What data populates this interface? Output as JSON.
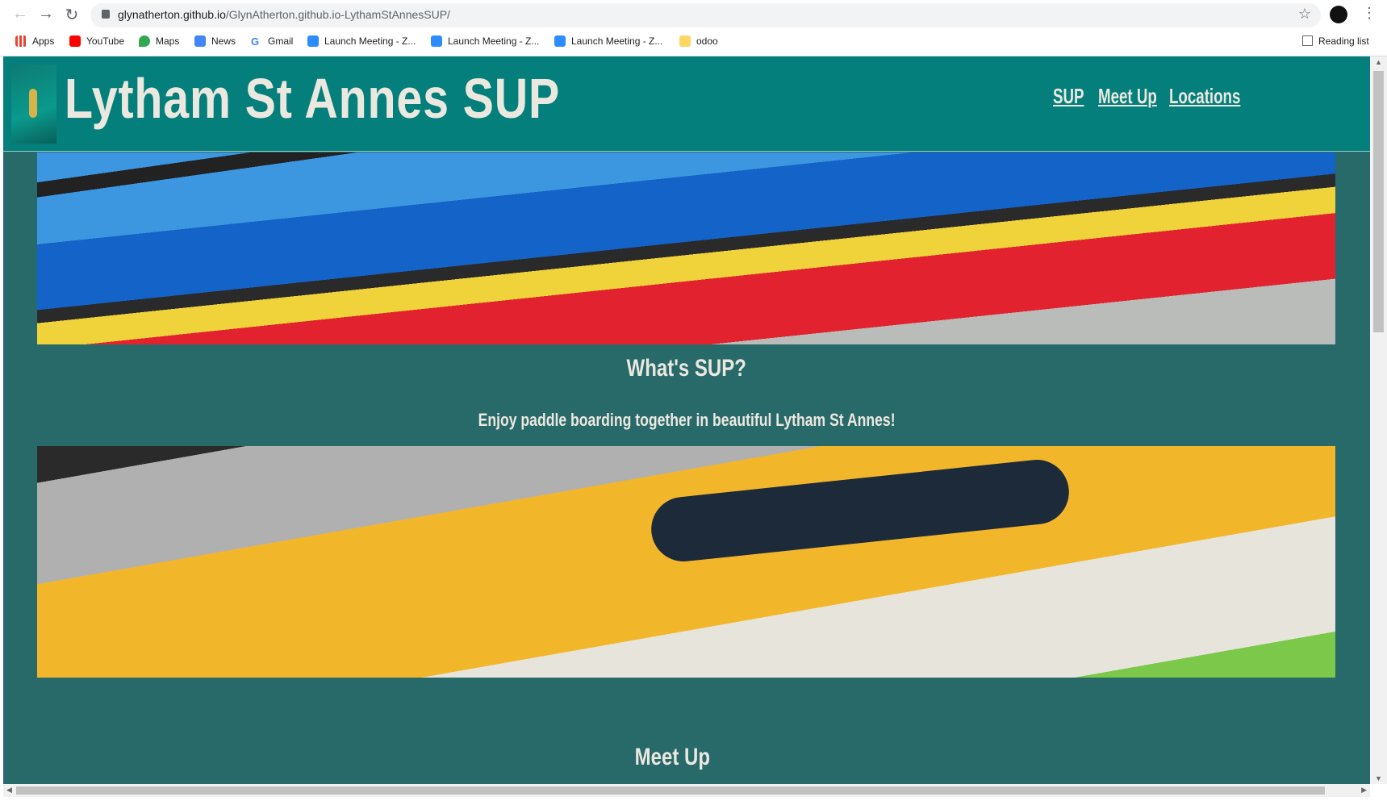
{
  "browser": {
    "url_host": "glynatherton.github.io",
    "url_path": "/GlynAtherton.github.io-LythamStAnnesSUP/",
    "bookmarks": [
      {
        "label": "Apps",
        "color": "#ea4335"
      },
      {
        "label": "YouTube",
        "color": "#ff0000"
      },
      {
        "label": "Maps",
        "color": "#34a853"
      },
      {
        "label": "News",
        "color": "#4285f4"
      },
      {
        "label": "Gmail",
        "color": "#4285f4"
      },
      {
        "label": "Launch Meeting - Z...",
        "color": "#2d8cff"
      },
      {
        "label": "Launch Meeting - Z...",
        "color": "#2d8cff"
      },
      {
        "label": "Launch Meeting - Z...",
        "color": "#2d8cff"
      },
      {
        "label": "odoo",
        "color": "#fdd663"
      }
    ],
    "reading_list": "Reading list"
  },
  "site": {
    "title": "Lytham St Annes SUP",
    "nav": [
      "SUP",
      "Meet Up",
      "Locations"
    ],
    "section_heading": "What's SUP?",
    "tagline": "Enjoy paddle boarding together in beautiful Lytham St Annes!",
    "next_heading": "Meet Up",
    "colors": {
      "header": "#047f7b",
      "body": "#28696a",
      "text": "#ebe8e0"
    }
  }
}
